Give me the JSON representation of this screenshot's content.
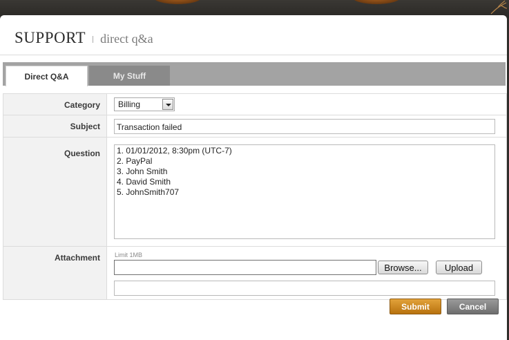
{
  "header": {
    "title": "SUPPORT",
    "subtitle": "direct q&a"
  },
  "tabs": [
    {
      "label": "Direct Q&A",
      "active": true
    },
    {
      "label": "My Stuff",
      "active": false
    }
  ],
  "form": {
    "category": {
      "label": "Category",
      "value": "Billing"
    },
    "subject": {
      "label": "Subject",
      "value": "Transaction failed"
    },
    "question": {
      "label": "Question",
      "value": "1. 01/01/2012, 8:30pm (UTC-7)\n2. PayPal\n3. John Smith\n4. David Smith\n5. JohnSmith707"
    },
    "attachment": {
      "label": "Attachment",
      "limit": "Limit 1MB",
      "browse_label": "Browse...",
      "upload_label": "Upload"
    }
  },
  "actions": {
    "submit_label": "Submit",
    "cancel_label": "Cancel"
  },
  "colors": {
    "submit": "#c98a22",
    "cancel": "#858585",
    "tabbar": "#a3a3a3"
  }
}
